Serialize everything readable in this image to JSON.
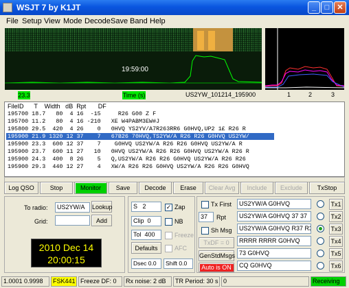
{
  "window": {
    "title": "WSJT 7    by K1JT"
  },
  "menu": [
    "File",
    "Setup",
    "View",
    "Mode",
    "Decode",
    "Save",
    "Band",
    "Help"
  ],
  "waterfall": {
    "time_label": "19:59:00"
  },
  "scale": {
    "left_value": "23.3",
    "time_label": "Time (s)",
    "file_name": "US2YW_101214_195900",
    "freq_label": "Freq (kHz)",
    "ticks": [
      "1",
      "2",
      "3"
    ]
  },
  "decodes": {
    "header": "FileID      T    Width   dB  Rpt       DF",
    "rows": [
      "195700 18.7   80  4 16  -15     R26 G00 Z F",
      "195700 11.2   80  4 16 -210   XE W4PABM3EW#J",
      "195800 29.5  420  4 26    0   0HVQ YS2YV/A7R263RR6 G0HVQ,UP2 1£ R26 R",
      "195900 21.9 1320 12 37    7   67B26 70HVQ,TS2YW/A R26 R26 G0HVQ US2YW/",
      "195900 23.3  600 12 37    7    G0HVQ US2YW/A R26 R26 G0HVQ US2YW/A R",
      "195900 23.7  600 11 27   10   0HVQ US2YW/A R26 R26 G0HVQ US2YW/A R26 R",
      "195900 24.3  400  8 26    5   Q,US2YW/A R26 R26 G0HVQ US2YW/A R26 R26",
      "195900 29.3  440 12 27    4   XW/A R26 R26 G0HVQ US2YW/A R26 R26 G0HVQ"
    ],
    "selected_index": 3
  },
  "buttons": {
    "log_qso": "Log QSO",
    "stop": "Stop",
    "monitor": "Monitor",
    "save": "Save",
    "decode": "Decode",
    "erase": "Erase",
    "clear_avg": "Clear Avg",
    "include": "Include",
    "exclude": "Exclude",
    "txstop": "TxStop"
  },
  "left_panel": {
    "to_radio_label": "To radio:",
    "to_radio_value": "US2YW/A",
    "lookup": "Lookup",
    "grid_label": "Grid:",
    "grid_value": "",
    "add": "Add",
    "date": "2010 Dec 14",
    "time": "20:00:15"
  },
  "mid_panel": {
    "s_label": "S",
    "s_value": "2",
    "zap": "Zap",
    "zap_checked": true,
    "clip_label": "Clip",
    "clip_value": "0",
    "nb": "NB",
    "tol_label": "Tol",
    "tol_value": "400",
    "freeze": "Freeze",
    "defaults": "Defaults",
    "afc": "AFC",
    "dsec_label": "Dsec",
    "dsec_value": "0.0",
    "shift_label": "Shift",
    "shift_value": "0.0"
  },
  "right_panel": {
    "tx_first": "Tx First",
    "rpt_value": "37",
    "rpt_label": "Rpt",
    "sh_msg": "Sh Msg",
    "txdf": "TxDF = 0",
    "gen_std_msgs": "GenStdMsgs",
    "auto_is_on": "Auto is ON",
    "messages": [
      "US2YW/A G0HVQ",
      "US2YW/A G0HVQ 37 37",
      "US2YW/A G0HVQ R37 R37",
      "RRRR RRRR G0HVQ",
      "73 G0HVQ",
      "CQ G0HVQ"
    ],
    "tx_labels": [
      "Tx1",
      "Tx2",
      "Tx3",
      "Tx4",
      "Tx5",
      "Tx6"
    ],
    "selected_tx": 2
  },
  "status": {
    "ratio": "1.0001 0.9998",
    "mode": "FSK441",
    "freeze_df": "Freeze DF:  0",
    "rx_noise": "Rx noise:  2 dB",
    "tr_period": "TR Period: 30 s",
    "extra": "0",
    "receiving": "Receiving"
  },
  "colors": {
    "accent_green": "#00d000",
    "mode_yellow": "#ffff00",
    "auto_red": "#ee2222",
    "selection_blue": "#316ac5"
  }
}
